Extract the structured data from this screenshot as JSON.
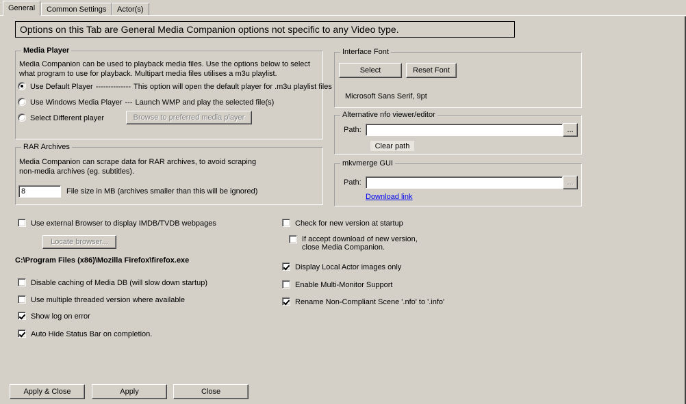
{
  "window": {
    "background_color": "#d4d0c8"
  },
  "tabs": [
    {
      "label": "General",
      "active": true
    },
    {
      "label": "Common Settings",
      "active": false
    },
    {
      "label": "Actor(s)",
      "active": false
    }
  ],
  "banner": {
    "text": "Options on this Tab are General Media Companion options not specific to any Video type."
  },
  "media_player_group": {
    "title": "Media Player",
    "description_line1": "Media Companion can be used to playback media files.  Use the options below to select",
    "description_line2": "what program to use for playback.  Multipart media files utilises a m3u playlist.",
    "options": [
      {
        "label": "Use Default Player",
        "dashes": "--------------",
        "detail": "This option will open the default player for .m3u playlist files",
        "selected": true
      },
      {
        "label": "Use Windows Media Player",
        "dashes": "---",
        "detail": "Launch WMP and play the selected file(s)",
        "selected": false
      },
      {
        "label": "Select Different player",
        "dashes": "",
        "detail": "",
        "selected": false
      }
    ],
    "browse_button": {
      "label": "Browse to preferred media player",
      "disabled": true
    }
  },
  "rar_group": {
    "title": "RAR Archives",
    "description_line1": "Media Companion can scrape data for RAR archives, to avoid scraping",
    "description_line2": "non-media archives (eg. subtitles).",
    "file_size_value": "8",
    "file_size_label": "File size in MB (archives smaller than this will be ignored)"
  },
  "interface_font_group": {
    "title": "Interface Font",
    "select_button": "Select",
    "reset_button": "Reset Font",
    "current_font": "Microsoft Sans Serif, 9pt"
  },
  "nfo_viewer_group": {
    "title": "Alternative nfo viewer/editor",
    "path_label": "Path:",
    "path_value": "",
    "browse_ellipsis": "...",
    "clear_button": "Clear path"
  },
  "mkvmerge_group": {
    "title": "mkvmerge GUI",
    "path_label": "Path:",
    "path_value": "",
    "browse_ellipsis": "...",
    "download_link": "Download link",
    "link_color": "#0000ee"
  },
  "left_checkboxes": [
    {
      "label": "Use external Browser to display IMDB/TVDB webpages",
      "checked": false
    },
    {
      "label": "Disable caching of Media DB (will slow down startup)",
      "checked": false
    },
    {
      "label": "Use multiple threaded version where available",
      "checked": false
    },
    {
      "label": "Show log on error",
      "checked": true
    },
    {
      "label": "Auto Hide Status Bar on completion.",
      "checked": true
    }
  ],
  "locate_browser_button": {
    "label": "Locate browser...",
    "disabled": true
  },
  "browser_path": "C:\\Program Files (x86)\\Mozilla Firefox\\firefox.exe",
  "right_checkboxes": [
    {
      "label": "Check for new version at startup",
      "checked": false
    },
    {
      "label_line1": "If accept download of new version,",
      "label_line2": "close Media Companion.",
      "checked": false,
      "indented": true
    },
    {
      "label": "Display Local Actor images only",
      "checked": true
    },
    {
      "label": "Enable Multi-Monitor Support",
      "checked": false
    },
    {
      "label": "Rename Non-Compliant Scene '.nfo' to '.info'",
      "checked": true
    }
  ],
  "footer_buttons": [
    {
      "label": "Apply  &  Close"
    },
    {
      "label": "Apply"
    },
    {
      "label": "Close"
    }
  ]
}
